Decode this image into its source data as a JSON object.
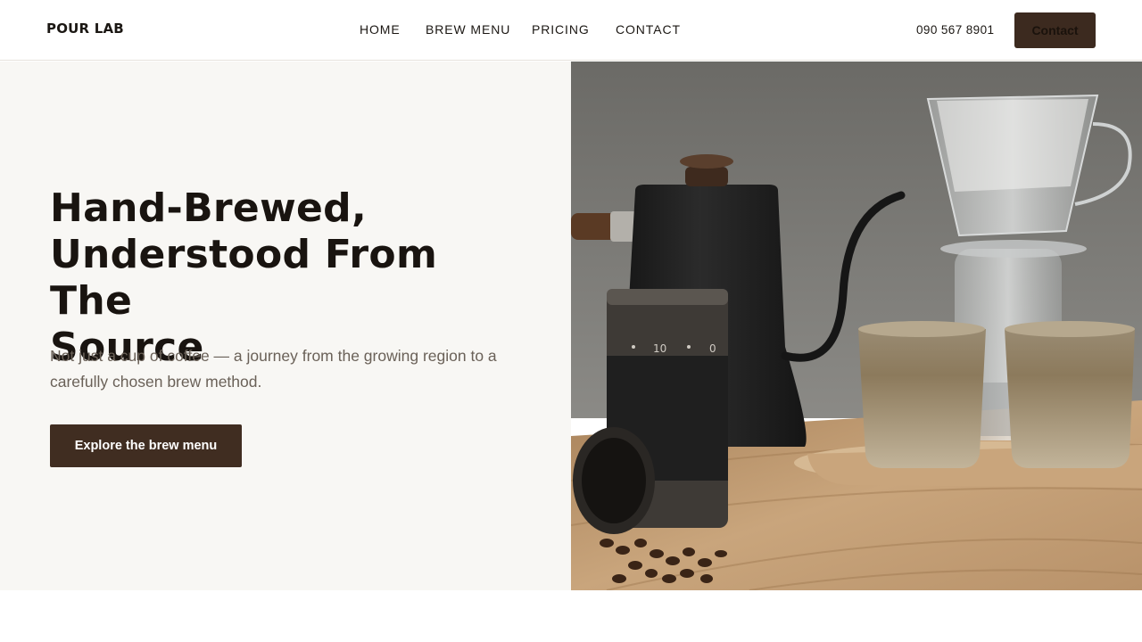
{
  "header": {
    "logo": "POUR LAB",
    "nav": [
      {
        "label": "HOME"
      },
      {
        "label": "BREW MENU"
      },
      {
        "label": "PRICING"
      },
      {
        "label": "CONTACT"
      }
    ],
    "phone": "090 567 8901",
    "contact_button": "Contact"
  },
  "hero": {
    "headline_lines": [
      "Hand-Brewed,",
      "Understood From The",
      "Source"
    ],
    "subtext": "Not just a cup of coffee — a journey from the growing region to a carefully chosen brew method.",
    "cta_label": "Explore the brew menu",
    "image": {
      "subject": "pour-over coffee set: gooseneck kettle, hand grinder, glass dripper and two ceramic cups on a wooden table",
      "grinder_dial_numbers": [
        "10",
        "0"
      ]
    }
  },
  "colors": {
    "brand_dark": "#402d21",
    "hero_bg": "#f8f7f4",
    "text": "#1b1713",
    "muted": "#6a6158"
  }
}
